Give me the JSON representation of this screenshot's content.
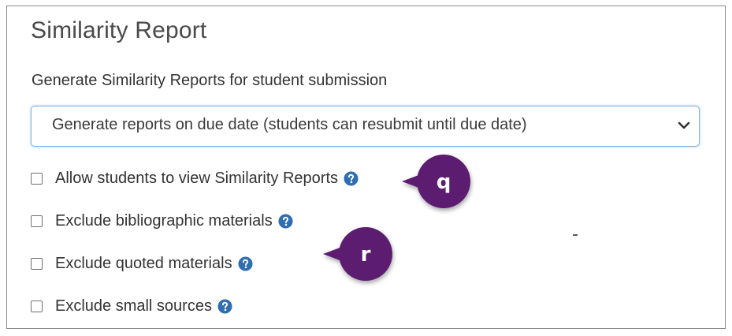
{
  "panel": {
    "title": "Similarity Report",
    "subheading": "Generate Similarity Reports for student submission"
  },
  "generate_select": {
    "selected": "Generate reports on due date (students can resubmit until due date)",
    "icon": "chevron-down-icon"
  },
  "options": [
    {
      "label": "Allow students to view Similarity Reports",
      "checked": false,
      "icon": "help-icon"
    },
    {
      "label": "Exclude bibliographic materials",
      "checked": false,
      "icon": "help-icon"
    },
    {
      "label": "Exclude quoted materials",
      "checked": false,
      "icon": "help-icon"
    },
    {
      "label": "Exclude small sources",
      "checked": false,
      "icon": "help-icon"
    }
  ],
  "callouts": [
    {
      "label": "q"
    },
    {
      "label": "r"
    }
  ],
  "colors": {
    "help_icon": "#2f6eb0",
    "callout": "#5b1f6f",
    "select_border": "#7fb3e0"
  }
}
